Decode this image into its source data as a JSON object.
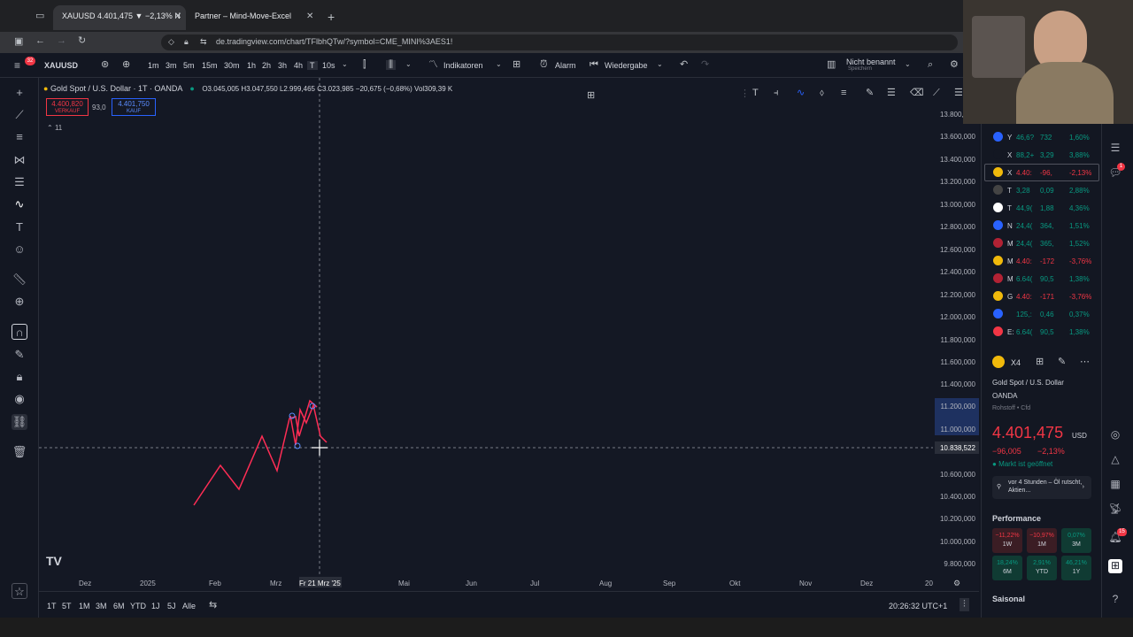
{
  "browser": {
    "tabs": [
      {
        "label": "XAUUSD 4.401,475 ▼ −2,13% N"
      },
      {
        "label": "Partner – Mind-Move-Excel"
      }
    ],
    "url": "de.tradingview.com/chart/TFlbhQTw/?symbol=CME_MINI%3AES1!"
  },
  "toolbar": {
    "symbol": "XAUUSD",
    "intervals": [
      "1m",
      "3m",
      "5m",
      "15m",
      "30m",
      "1h",
      "2h",
      "3h",
      "4h",
      "T",
      "10s"
    ],
    "indicators_label": "Indikatoren",
    "alarm_label": "Alarm",
    "replay_label": "Wiedergabe",
    "layout_name": "Nicht benannt",
    "layout_sub": "Speichern"
  },
  "legend": {
    "title": "Gold Spot / U.S. Dollar · 1T · OANDA",
    "ohlc": "O3.045,005  H3.047,550  L2.999,465  C3.023,985  −20,675 (−0,68%)  Vol309,39 K",
    "sell_price": "4.400,820",
    "sell_label": "VERKAUF",
    "spread": "93,0",
    "buy_price": "4.401,750",
    "buy_label": "KAUF",
    "indicators_count": "11"
  },
  "price_axis": {
    "labels": [
      "13.800,000",
      "13.600,000",
      "13.400,000",
      "13.200,000",
      "13.000,000",
      "12.800,000",
      "12.600,000",
      "12.400,000",
      "12.200,000",
      "12.000,000",
      "11.800,000",
      "11.600,000",
      "11.400,000",
      "11.200,000",
      "11.000,000",
      "10.838,522",
      "10.600,000",
      "10.400,000",
      "10.200,000",
      "10.000,000",
      "9.800,000"
    ],
    "crosshair_price": "10.838,522"
  },
  "time_axis": {
    "labels": [
      "Dez",
      "2025",
      "Feb",
      "Mrz",
      "Fr 21 Mrz '25",
      "Mai",
      "Jun",
      "Jul",
      "Aug",
      "Sep",
      "Okt",
      "Nov",
      "Dez",
      "20"
    ]
  },
  "bottom": {
    "ranges": [
      "1T",
      "5T",
      "1M",
      "3M",
      "6M",
      "YTD",
      "1J",
      "5J",
      "Alle"
    ],
    "clock": "20:26:32 UTC+1"
  },
  "watchlist": {
    "rows": [
      {
        "sym": "Y",
        "last": "46,6?",
        "chg": "732",
        "pct": "1,60%",
        "dir": "up",
        "color": "#2962ff"
      },
      {
        "sym": "X",
        "last": "88,2+",
        "chg": "3,29",
        "pct": "3,88%",
        "dir": "up",
        "color": "#131722"
      },
      {
        "sym": "X",
        "last": "4.40:",
        "chg": "-96,",
        "pct": "-2,13%",
        "dir": "down",
        "color": "#f0b90b"
      },
      {
        "sym": "T",
        "last": "3,28",
        "chg": "0,09",
        "pct": "2,88%",
        "dir": "up",
        "color": "#444"
      },
      {
        "sym": "T",
        "last": "44,9(",
        "chg": "1,88",
        "pct": "4,36%",
        "dir": "up",
        "color": "#fff"
      },
      {
        "sym": "N",
        "last": "24,4(",
        "chg": "364,",
        "pct": "1,51%",
        "dir": "up",
        "color": "#2962ff"
      },
      {
        "sym": "M",
        "last": "24,4(",
        "chg": "365,",
        "pct": "1,52%",
        "dir": "up",
        "color": "#b22234"
      },
      {
        "sym": "M",
        "last": "4.40:",
        "chg": "-172",
        "pct": "-3,76%",
        "dir": "down",
        "color": "#f0b90b"
      },
      {
        "sym": "M",
        "last": "6.64(",
        "chg": "90,5",
        "pct": "1,38%",
        "dir": "up",
        "color": "#b22234"
      },
      {
        "sym": "G",
        "last": "4.40:",
        "chg": "-171",
        "pct": "-3,76%",
        "dir": "down",
        "color": "#f0b90b"
      },
      {
        "sym": "",
        "last": "125,:",
        "chg": "0,46",
        "pct": "0,37%",
        "dir": "up",
        "color": "#2962ff"
      },
      {
        "sym": "E:",
        "last": "6.64(",
        "chg": "90,5",
        "pct": "1,38%",
        "dir": "up",
        "color": "#f23645"
      }
    ]
  },
  "details": {
    "symbol_short": "X4",
    "name": "Gold Spot / U.S. Dollar",
    "exchange": "OANDA",
    "category": "Rohstoff • Cfd",
    "price": "4.401,475",
    "currency": "USD",
    "change": "−96,005",
    "change_pct": "−2,13%",
    "market_status": "Markt ist geöffnet",
    "news_time": "vor 4 Stunden",
    "news_text": "Öl rutscht, Aktien...",
    "performance_label": "Performance",
    "performance": [
      {
        "value": "−11,22%",
        "period": "1W",
        "dir": "down"
      },
      {
        "value": "−10,97%",
        "period": "1M",
        "dir": "down"
      },
      {
        "value": "0,07%",
        "period": "3M",
        "dir": "up"
      },
      {
        "value": "18,24%",
        "period": "6M",
        "dir": "up"
      },
      {
        "value": "2,91%",
        "period": "YTD",
        "dir": "up"
      },
      {
        "value": "46,21%",
        "period": "1Y",
        "dir": "up"
      }
    ],
    "seasonal_label": "Saisonal"
  },
  "colors": {
    "accent": "#2962ff",
    "up": "#089981",
    "down": "#f23645",
    "drawing": "#ff2d55"
  }
}
